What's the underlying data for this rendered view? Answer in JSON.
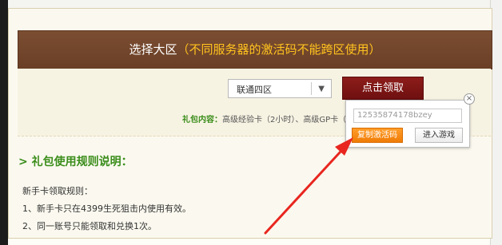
{
  "header": {
    "title": "选择大区",
    "subtitle": "（不同服务器的激活码不能跨区使用）"
  },
  "form": {
    "server_select_value": "联通四区",
    "claim_button": "点击领取",
    "package_label": "礼包内容：",
    "package_items": "高级经验卡（2小时）、高级GP卡（2"
  },
  "popup": {
    "code_value": "12535874178bzey",
    "copy_button": "复制激活码",
    "enter_game_button": "进入游戏",
    "close_glyph": "×"
  },
  "rules": {
    "title": "> 礼包使用规则说明：",
    "subheading": "新手卡领取规则：",
    "items": [
      "1、新手卡只在4399生死狙击内使用有效。",
      "2、同一账号只能领取和兑换1次。"
    ]
  },
  "colors": {
    "header_bg": "#6f4329",
    "subtitle_highlight": "#ffc21e",
    "claim_button_bg": "#7d1715",
    "copy_button_bg": "#f7870f",
    "rules_title": "#3a8d1a",
    "annotation_arrow": "#e8261f"
  },
  "icons": {
    "select_arrow": "chevron-down-icon",
    "popup_close": "close-icon",
    "annotation": "red-arrow-icon"
  }
}
